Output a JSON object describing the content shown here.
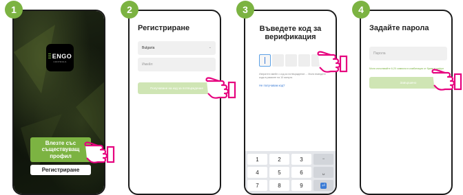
{
  "steps": [
    "1",
    "2",
    "3",
    "4"
  ],
  "screen1": {
    "logo_brand": "ENGO",
    "logo_sub": "CONTROLS",
    "login_button": "Влезте със съществуващ профил",
    "register_button": "Регистриране"
  },
  "screen2": {
    "title": "Регистриране",
    "country_value": "Bulgaria",
    "email_placeholder": "Имейл",
    "get_code_button": "Получаване на код за потвърждение"
  },
  "screen3": {
    "title": "Въведете код за верификация",
    "hint": "Изпратен имейл с код за потвърждение ... Моля въведете кода в рамките на 10 минути.",
    "resend_link": "Не получавам код?",
    "keys": [
      "1",
      "2",
      "3",
      "−",
      "4",
      "5",
      "6",
      "␣",
      "7",
      "8",
      "9",
      "go"
    ]
  },
  "screen4": {
    "title": "Задайте парола",
    "password_placeholder": "Парола",
    "password_hint": "Моля използвайте 6-20 символа в комбинация от букви и цифри",
    "done_button": "Завършено"
  },
  "colors": {
    "accent": "#7cb342",
    "accent_pale": "#cfe5b4",
    "link": "#3a7bd5",
    "hand": "#e6007e"
  }
}
